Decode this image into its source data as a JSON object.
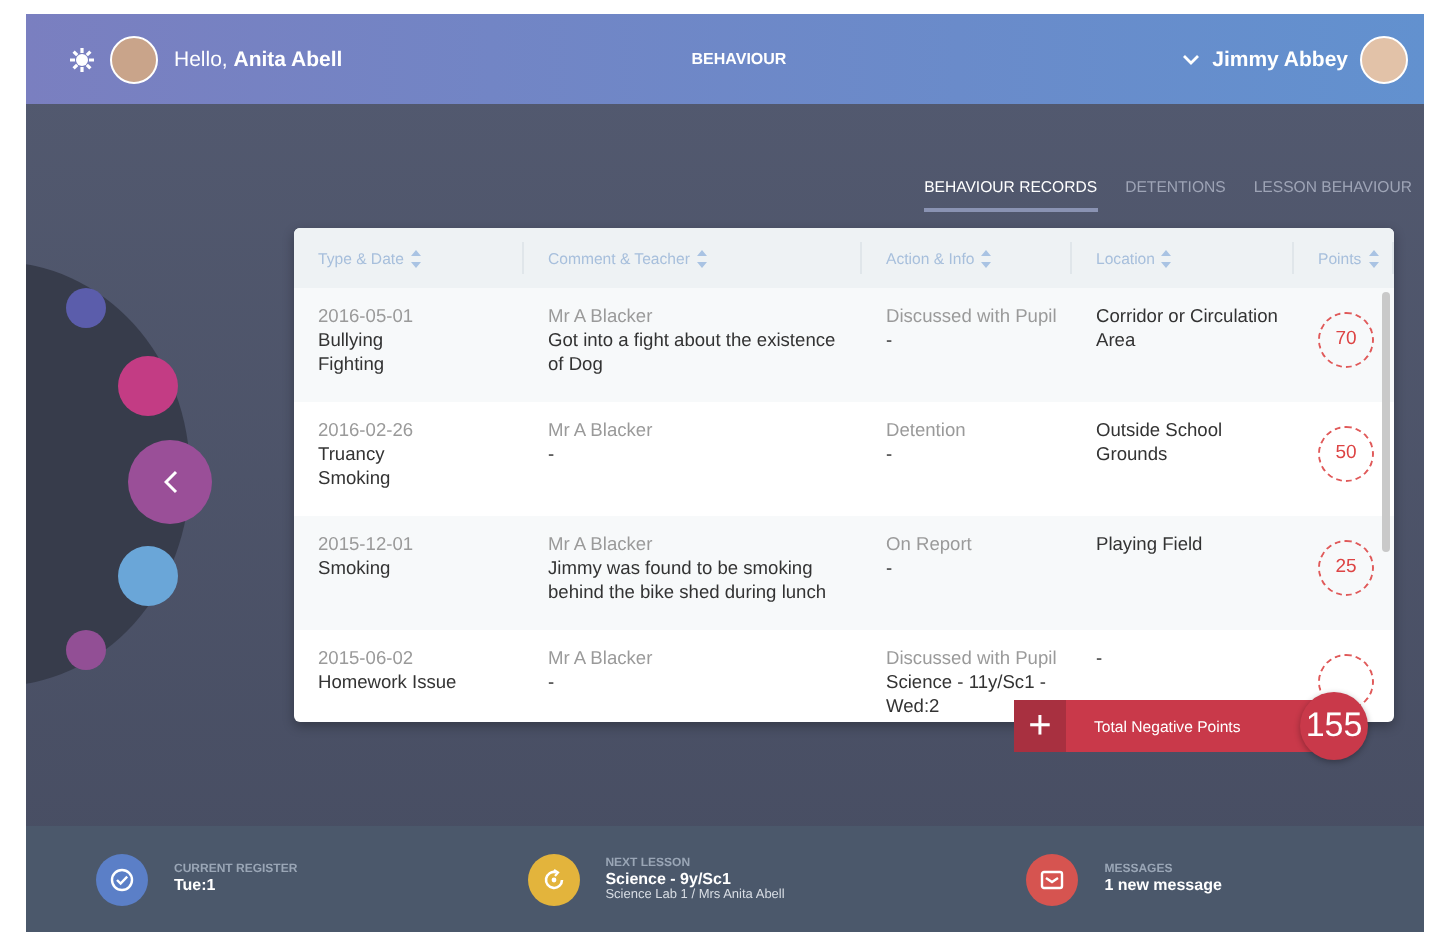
{
  "header": {
    "greeting": "Hello,",
    "user_name": "Anita Abell",
    "title": "BEHAVIOUR",
    "student_name": "Jimmy Abbey"
  },
  "tabs": [
    {
      "label": "BEHAVIOUR RECORDS",
      "selected": true
    },
    {
      "label": "DETENTIONS",
      "selected": false
    },
    {
      "label": "LESSON BEHAVIOUR",
      "selected": false
    }
  ],
  "side_menu": [
    {
      "kind": "dot",
      "color": "#5b5dab"
    },
    {
      "kind": "dot",
      "color": "#c33c84"
    },
    {
      "kind": "back",
      "color": "#9a4f98"
    },
    {
      "kind": "dot",
      "color": "#6aa6d8"
    },
    {
      "kind": "dot",
      "color": "#924f95"
    }
  ],
  "table": {
    "columns": [
      "Type & Date",
      "Comment & Teacher",
      "Action & Info",
      "Location",
      "Points"
    ],
    "rows": [
      {
        "date": "2016-05-01",
        "types": "Bullying\nFighting",
        "teacher": "Mr A Blacker",
        "comment": "Got into a fight about the existence of Dog",
        "action": "Discussed with Pupil",
        "info": "-",
        "location": "Corridor or Circulation Area",
        "points": "70"
      },
      {
        "date": "2016-02-26",
        "types": "Truancy\nSmoking",
        "teacher": "Mr A Blacker",
        "comment": "-",
        "action": "Detention",
        "info": "-",
        "location": "Outside School Grounds",
        "points": "50"
      },
      {
        "date": "2015-12-01",
        "types": "Smoking",
        "teacher": "Mr A Blacker",
        "comment": "Jimmy was found to be smoking behind the bike shed during lunch",
        "action": "On Report",
        "info": "-",
        "location": "Playing Field",
        "points": "25"
      },
      {
        "date": "2015-06-02",
        "types": "Homework Issue",
        "teacher": "Mr A Blacker",
        "comment": "-",
        "action": "Discussed with Pupil",
        "info": "Science - 11y/Sc1 - Wed:2",
        "location": "-"
      }
    ]
  },
  "total": {
    "add_symbol": "+",
    "label": "Total Negative Points",
    "value": "155"
  },
  "footer": [
    {
      "kind": "register",
      "color": "#5b7fc7",
      "label": "CURRENT REGISTER",
      "value": "Tue:1"
    },
    {
      "kind": "lesson",
      "color": "#e3b43c",
      "label": "NEXT LESSON",
      "value": "Science - 9y/Sc1",
      "detail": "Science Lab 1 / Mrs Anita Abell"
    },
    {
      "kind": "messages",
      "color": "#d65450",
      "label": "MESSAGES",
      "value": "1 new message"
    }
  ]
}
